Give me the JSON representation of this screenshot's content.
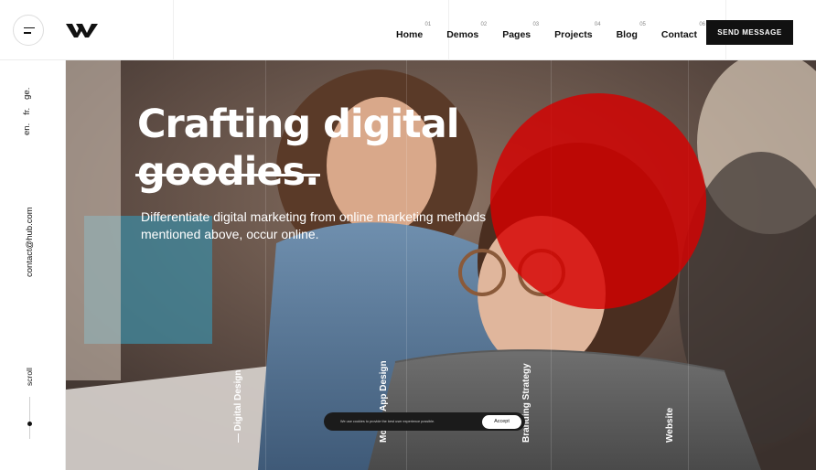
{
  "header": {
    "logo_icon": "w-logo-icon",
    "menu_icon": "hamburger-menu-icon",
    "nav": [
      {
        "num": "01",
        "label": "Home"
      },
      {
        "num": "02",
        "label": "Demos"
      },
      {
        "num": "03",
        "label": "Pages"
      },
      {
        "num": "04",
        "label": "Projects"
      },
      {
        "num": "05",
        "label": "Blog"
      },
      {
        "num": "06",
        "label": "Contact"
      }
    ],
    "cta_label": "SEND MESSAGE"
  },
  "sidebar": {
    "languages": [
      "en.",
      "fr.",
      "ge."
    ],
    "contact_email": "contact@hub.com",
    "scroll_label": "scroll"
  },
  "hero": {
    "title_line1": "Crafting digital",
    "title_line2": "goodies.",
    "subtitle": "Differentiate digital marketing from online marketing methods mentioned above, occur online.",
    "accent_color": "#d60000",
    "categories": [
      "— Digital Design",
      "Mobile App Design",
      "Branding Strategy",
      "Website"
    ]
  },
  "cookie": {
    "text": "We use cookies to provide the best user experience possible.",
    "accept_label": "Accept"
  }
}
